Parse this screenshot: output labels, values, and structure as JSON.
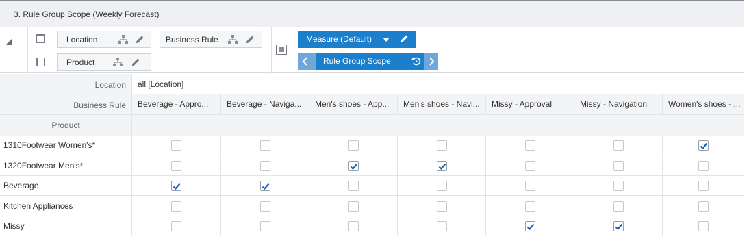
{
  "window": {
    "title": "3. Rule Group Scope (Weekly Forecast)"
  },
  "pivot": {
    "row_dims": [
      {
        "label": "Location"
      },
      {
        "label": "Product"
      }
    ],
    "col_dims": [
      {
        "label": "Business Rule"
      }
    ],
    "measure": {
      "label": "Measure (Default)"
    },
    "measure_nav": {
      "label": "Rule Group Scope"
    }
  },
  "grid": {
    "page_label": "Location",
    "page_value": "all [Location]",
    "col_dim_label": "Business Rule",
    "row_dim_label": "Product",
    "columns": [
      "Beverage - Appro...",
      "Beverage - Naviga...",
      "Men's shoes - App...",
      "Men's shoes - Navi...",
      "Missy - Approval",
      "Missy - Navigation",
      "Women's shoes - ..."
    ],
    "rows": [
      {
        "label": "1310Footwear Women's*",
        "checked": [
          false,
          false,
          false,
          false,
          false,
          false,
          true
        ]
      },
      {
        "label": "1320Footwear Men's*",
        "checked": [
          false,
          false,
          true,
          true,
          false,
          false,
          false
        ]
      },
      {
        "label": "Beverage",
        "checked": [
          true,
          true,
          false,
          false,
          false,
          false,
          false
        ]
      },
      {
        "label": "Kitchen Appliances",
        "checked": [
          false,
          false,
          false,
          false,
          false,
          false,
          false
        ]
      },
      {
        "label": "Missy",
        "checked": [
          false,
          false,
          false,
          false,
          true,
          true,
          false
        ]
      }
    ]
  },
  "colors": {
    "accent": "#1b7fcc",
    "accent_light": "#6fa8d8",
    "check": "#1565c0",
    "header_bg": "#f3f4f6",
    "title_bg": "#eef0f3"
  },
  "icons": {
    "collapse": "collapse-triangle-icon",
    "hierarchy": "hierarchy-tree-icon",
    "edit": "pencil-icon",
    "dropdown": "chevron-down-icon",
    "prev": "chevron-left-icon",
    "next": "chevron-right-icon",
    "reset": "reset-icon",
    "checkbox": "checkbox-icon"
  }
}
